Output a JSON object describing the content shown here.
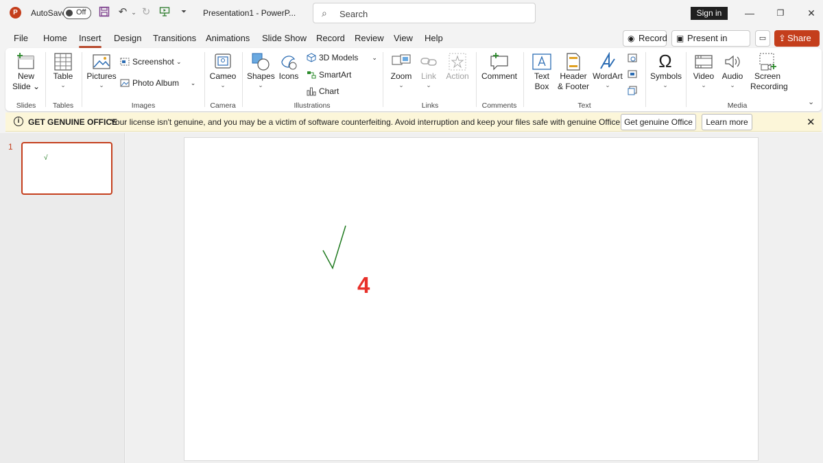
{
  "app": {
    "logo_letter": "P",
    "autosave_label": "AutoSave",
    "autosave_state": "Off",
    "doc_title": "Presentation1  -  PowerP...",
    "search_placeholder": "Search",
    "sign_in": "Sign in"
  },
  "menu": {
    "tabs": [
      "File",
      "Home",
      "Insert",
      "Design",
      "Transitions",
      "Animations",
      "Slide Show",
      "Record",
      "Review",
      "View",
      "Help"
    ],
    "active_tab": "Insert",
    "record_btn": "Record",
    "present_btn": "Present in Teams",
    "share_btn": "Share"
  },
  "ribbon": {
    "new_slide": [
      "New",
      "Slide"
    ],
    "table": "Table",
    "pictures": "Pictures",
    "screenshot": "Screenshot",
    "photo_album": "Photo Album",
    "cameo": "Cameo",
    "shapes": "Shapes",
    "icons": "Icons",
    "models_3d": "3D Models",
    "smartart": "SmartArt",
    "chart": "Chart",
    "zoom": "Zoom",
    "link": "Link",
    "action": "Action",
    "comment": "Comment",
    "text_box": [
      "Text",
      "Box"
    ],
    "header_footer": [
      "Header",
      "& Footer"
    ],
    "wordart": "WordArt",
    "symbols": "Symbols",
    "video": "Video",
    "audio": "Audio",
    "screen_recording": [
      "Screen",
      "Recording"
    ],
    "groups": {
      "slides": "Slides",
      "tables": "Tables",
      "images": "Images",
      "camera": "Camera",
      "illustrations": "Illustrations",
      "links": "Links",
      "comments": "Comments",
      "text": "Text",
      "media": "Media"
    }
  },
  "notice": {
    "heading": "GET GENUINE OFFICE",
    "message": "Your license isn't genuine, and you may be a victim of software counterfeiting. Avoid interruption and keep your files safe with genuine Office today.",
    "get_genuine": "Get genuine Office",
    "learn_more": "Learn more"
  },
  "slides": {
    "thumb_number": "1",
    "thumb_mark": "√",
    "annotation_number": "4"
  },
  "colors": {
    "accent": "#c43e1c",
    "annotation": "#e8302a",
    "check": "#1f7a1f"
  }
}
